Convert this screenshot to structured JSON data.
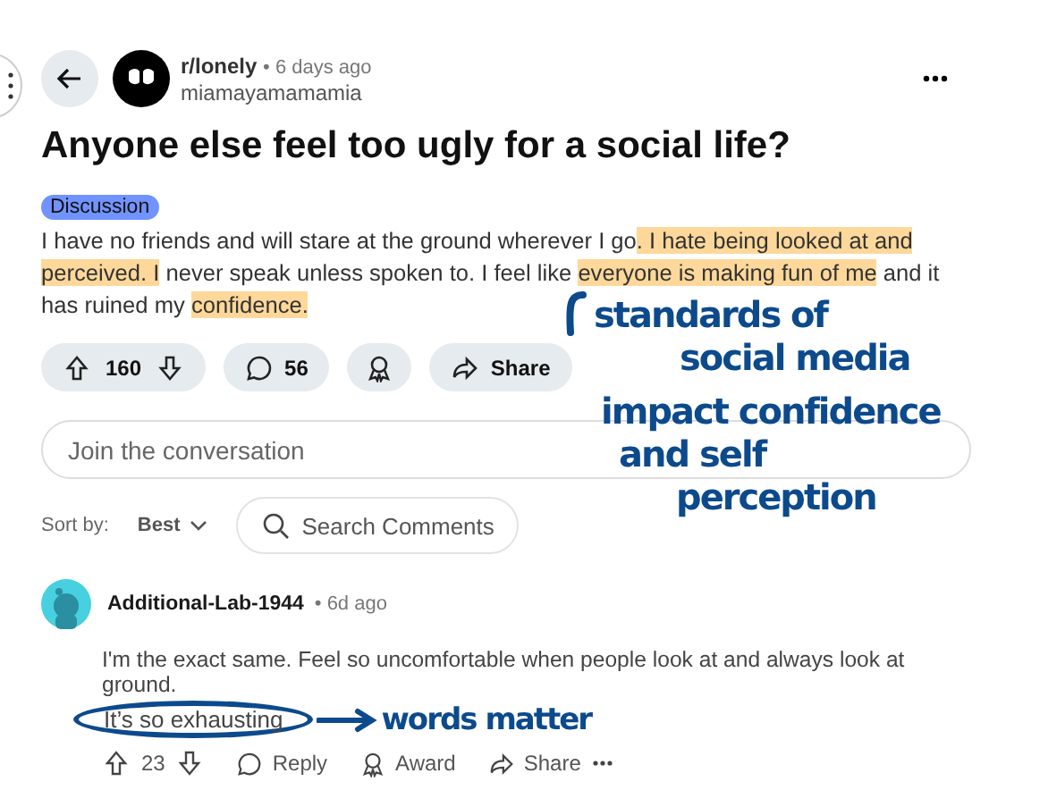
{
  "post": {
    "subreddit": "r/lonely",
    "time": "• 6 days ago",
    "author": "miamayamamamia",
    "title": "Anyone else feel too ugly for a social life?",
    "flair": "Discussion",
    "body": [
      {
        "text": "I have no friends and will stare at the ground wherever I go",
        "highlighted": false
      },
      {
        "text": ". I hate being looked at and perceived. I",
        "highlighted": true
      },
      {
        "text": " never speak unless spoken to. I feel like ",
        "highlighted": false
      },
      {
        "text": "everyone is making fun of me",
        "highlighted": true
      },
      {
        "text": " and it has ruined my ",
        "highlighted": false
      },
      {
        "text": "confidence.",
        "highlighted": true
      }
    ],
    "votes": "160",
    "comments": "56",
    "share": "Share"
  },
  "comment_box": {
    "placeholder": "Join the conversation"
  },
  "sort": {
    "label": "Sort by:",
    "value": "Best"
  },
  "search": {
    "placeholder": "Search Comments"
  },
  "comment": {
    "author": "Additional-Lab-1944",
    "time": "• 6d ago",
    "text": "I'm the exact same. Feel so uncomfortable when people look at and always look at ground.",
    "circled_text": "It’s so exhausting",
    "votes": "23",
    "actions": [
      "Reply",
      "Award",
      "Share"
    ]
  },
  "annotations": [
    {
      "text": "standards of",
      "kind": "note"
    },
    {
      "text": "social media",
      "kind": "note"
    },
    {
      "text": "impact confidence",
      "kind": "note"
    },
    {
      "text": "and self",
      "kind": "note"
    },
    {
      "text": "perception",
      "kind": "note"
    },
    {
      "text": "words matter",
      "kind": "tag"
    }
  ]
}
